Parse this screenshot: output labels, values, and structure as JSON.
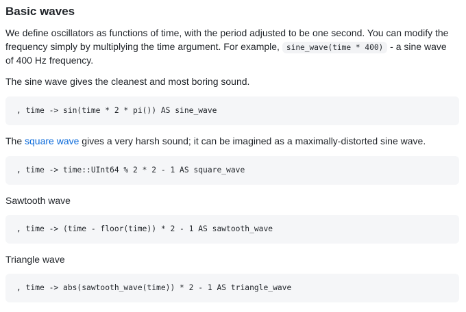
{
  "heading": "Basic waves",
  "intro": {
    "text1": "We define oscillators as functions of time, with the period adjusted to be one second. You can modify the frequency simply by multiplying the time argument. For example, ",
    "code": "sine_wave(time * 400)",
    "text2": " - a sine wave of 400 Hz frequency."
  },
  "sine": {
    "description": "The sine wave gives the cleanest and most boring sound.",
    "code": ", time -> sin(time * 2 * pi()) AS sine_wave"
  },
  "square": {
    "prefix": "The ",
    "link_text": "square wave",
    "suffix": " gives a very harsh sound; it can be imagined as a maximally-distorted sine wave.",
    "code": ", time -> time::UInt64 % 2 * 2 - 1 AS square_wave"
  },
  "sawtooth": {
    "description": "Sawtooth wave",
    "code": ", time -> (time - floor(time)) * 2 - 1 AS sawtooth_wave"
  },
  "triangle": {
    "description": "Triangle wave",
    "code": ", time -> abs(sawtooth_wave(time)) * 2 - 1 AS triangle_wave"
  },
  "colors": {
    "link": "#0969da",
    "code_background": "#f5f6f8",
    "text": "#1f2328"
  }
}
